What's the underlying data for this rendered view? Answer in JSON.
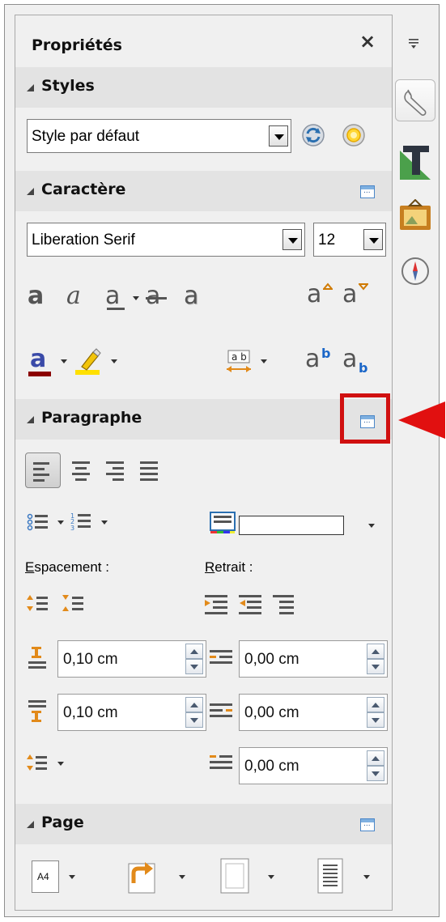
{
  "panel": {
    "title": "Propriétés",
    "close_icon": "×"
  },
  "styles": {
    "title": "Styles",
    "style_value": "Style par défaut"
  },
  "character": {
    "title": "Caractère",
    "font_name": "Liberation Serif",
    "font_size": "12",
    "glyph_a": "a",
    "glyph_italic": "a"
  },
  "paragraph": {
    "title": "Paragraphe",
    "spacing_label": "Espacement :",
    "spacing_mnemonic": "E",
    "spacing_rest": "spacement :",
    "indent_label": "Retrait :",
    "indent_mnemonic": "R",
    "indent_rest": "etrait :",
    "above_spacing": "0,10 cm",
    "below_spacing": "0,10 cm",
    "before_indent": "0,00 cm",
    "after_indent": "0,00 cm",
    "first_line_indent": "0,00 cm"
  },
  "page": {
    "title": "Page",
    "size_label": "A4"
  },
  "colors": {
    "highlight_frame": "#d01010",
    "arrow": "#e11010",
    "font_color_bar": "#8b0000",
    "highlight_bar": "#ffe000"
  },
  "icons": {
    "sidebar_menu": "sidebar-menu-icon",
    "properties_tab": "wrench-icon",
    "styles_tab": "styles-T-icon",
    "gallery_tab": "gallery-icon",
    "navigator_tab": "navigator-compass-icon"
  }
}
